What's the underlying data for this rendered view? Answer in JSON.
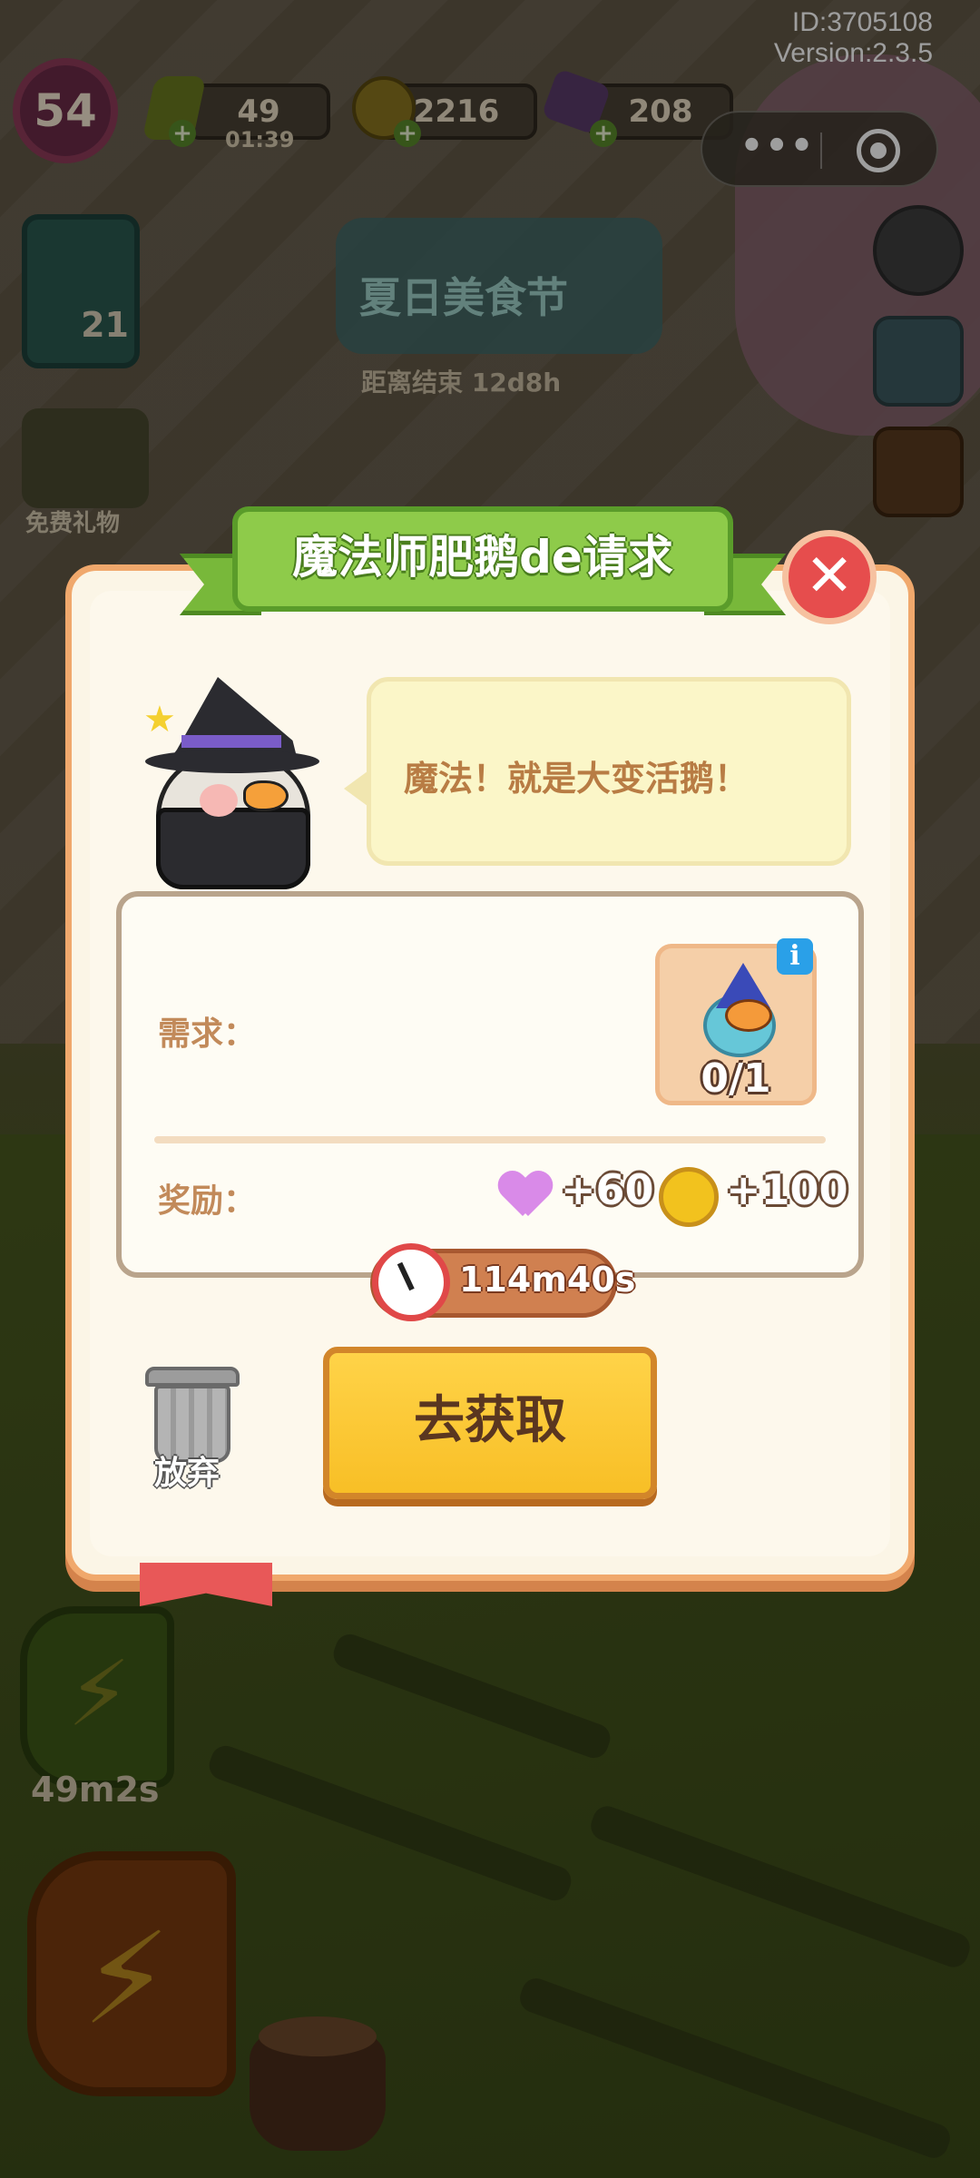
{
  "hud": {
    "id_text": "ID:3705108",
    "version_text": "Version:2.3.5",
    "level": "54",
    "energy": "49",
    "energy_timer": "01:39",
    "coins": "2216",
    "gems": "208",
    "clover_count": "21"
  },
  "event": {
    "banner_title": "夏日美食节",
    "countdown": "距离结束 12d8h"
  },
  "side": {
    "free_gift_label": "免费礼物"
  },
  "bottom": {
    "small_boost_timer": "49m2s"
  },
  "dialog": {
    "title": "魔法师肥鹅de请求",
    "close_label": "✕",
    "speech": "魔法！就是大变活鹅！",
    "requirement_label": "需求：",
    "requirement_progress": "0/1",
    "info_label": "i",
    "reward_label": "奖励：",
    "reward_hearts": "+60",
    "reward_coins": "+100",
    "timer": "114m40s",
    "abandon_label": "放弃",
    "go_button_label": "去获取"
  },
  "colors": {
    "dialog_bg": "#fbf5e6",
    "ribbon_green": "#8ecb4a",
    "close_red": "#e64d4d",
    "button_yellow": "#f8bf26"
  }
}
